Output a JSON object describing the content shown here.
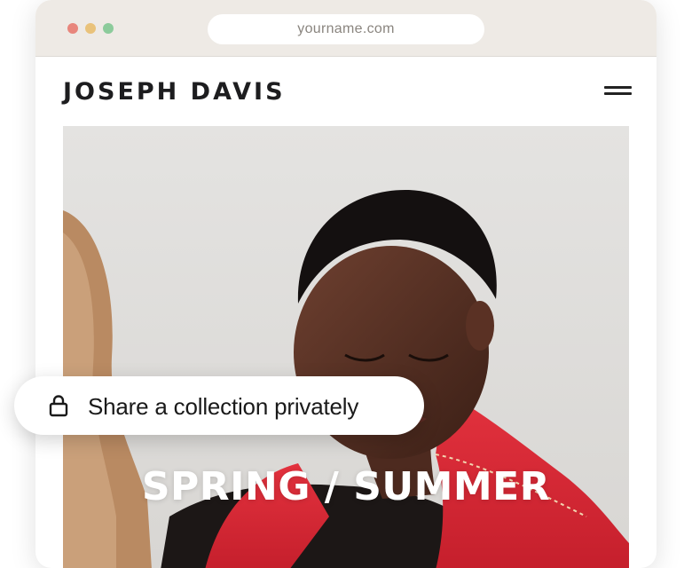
{
  "browser": {
    "url": "yourname.com",
    "window_dots": [
      {
        "name": "close",
        "color": "#e8867c"
      },
      {
        "name": "minimize",
        "color": "#e9c27a"
      },
      {
        "name": "maximize",
        "color": "#8ccb9b"
      }
    ]
  },
  "site": {
    "brand": "JOSEPH DAVIS",
    "menu_icon": "hamburger-menu-icon",
    "hero": {
      "title": "SPRING / SUMMER",
      "image": "fashion-model-red-jacket-photo"
    }
  },
  "share": {
    "icon": "lock-icon",
    "label": "Share a collection privately"
  }
}
